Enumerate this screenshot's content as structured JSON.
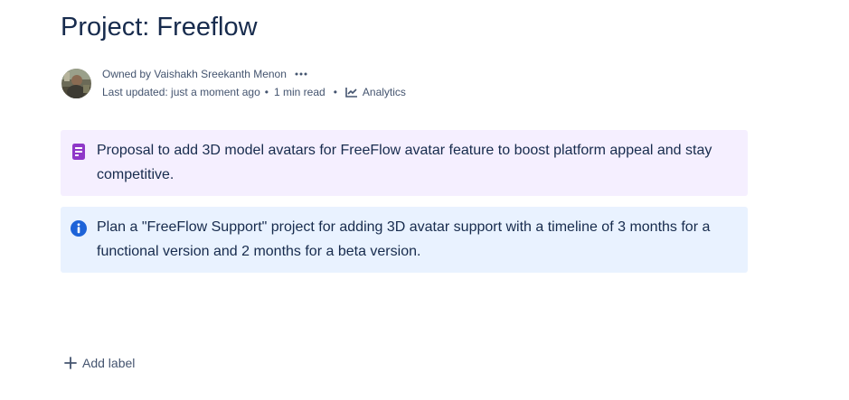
{
  "page": {
    "title": "Project: Freeflow"
  },
  "byline": {
    "owner_text": "Owned by Vaishakh Sreekanth Menon",
    "last_updated": "Last updated: just a moment ago",
    "read_time": "1 min read",
    "analytics_label": "Analytics",
    "more_icon": "more-horizontal-icon",
    "analytics_icon": "line-chart-icon"
  },
  "panels": [
    {
      "type": "note",
      "icon": "note-icon",
      "icon_color": "#8f38c8",
      "background": "#f5efff",
      "text": "Proposal to add 3D model avatars for FreeFlow avatar feature to boost platform appeal and stay competitive."
    },
    {
      "type": "info",
      "icon": "info-icon",
      "icon_color": "#1d63d8",
      "background": "#e9f2ff",
      "text": "Plan a \"FreeFlow Support\" project for adding 3D avatar support with a timeline of 3 months for a functional version and 2 months for a beta version."
    }
  ],
  "labels": {
    "add_label": "Add label",
    "add_icon": "plus-icon"
  }
}
